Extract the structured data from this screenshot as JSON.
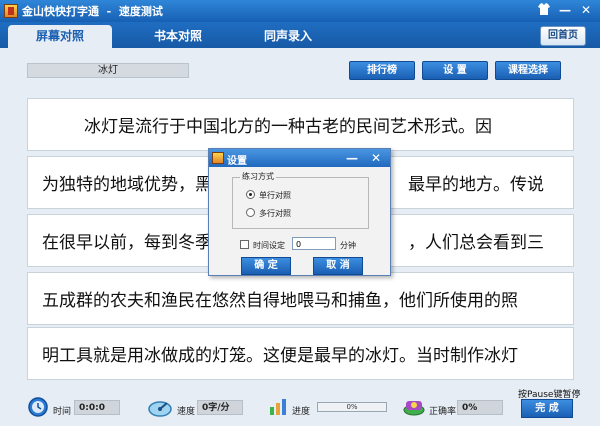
{
  "window": {
    "title": "金山快快打字通  -  速度测试",
    "icons": [
      "app-icon",
      "skin-icon",
      "minimize-icon",
      "close-icon"
    ]
  },
  "tabs": [
    {
      "label": "屏幕对照",
      "active": true
    },
    {
      "label": "书本对照",
      "active": false
    },
    {
      "label": "同声录入",
      "active": false
    }
  ],
  "home_button": "回首页",
  "lesson_title": "冰灯",
  "toolbar": {
    "ranking": "排行榜",
    "settings": "设  置",
    "course_select": "课程选择"
  },
  "text_lines": [
    "冰灯是流行于中国北方的一种古老的民间艺术形式。因",
    "为独特的地域优势，黑",
    "在很早以前，每到冬季",
    "五成群的农夫和渔民在悠然自得地喂马和捕鱼，他们所使用的照",
    "明工具就是用冰做成的灯笼。这便是最早的冰灯。当时制作冰灯"
  ],
  "text_tails": [
    "",
    "最早的地方。传说",
    "，人们总会看到三",
    "",
    ""
  ],
  "dialog": {
    "title": "设置",
    "group_label": "练习方式",
    "options": [
      {
        "label": "单行对照",
        "selected": true
      },
      {
        "label": "多行对照",
        "selected": false
      }
    ],
    "time_setting_label": "时间设定",
    "time_value": "0",
    "time_unit": "分钟",
    "time_checked": false,
    "ok": "确  定",
    "cancel": "取  消"
  },
  "status": {
    "time_label": "时间",
    "time_value": "0:0:0",
    "speed_label": "速度",
    "speed_value": "0字/分",
    "progress_label": "进度",
    "progress_value": "0%",
    "progress_fraction": 0,
    "accuracy_label": "正确率",
    "accuracy_value": "0%",
    "pause_hint": "按Pause键暂停",
    "done": "完  成"
  }
}
